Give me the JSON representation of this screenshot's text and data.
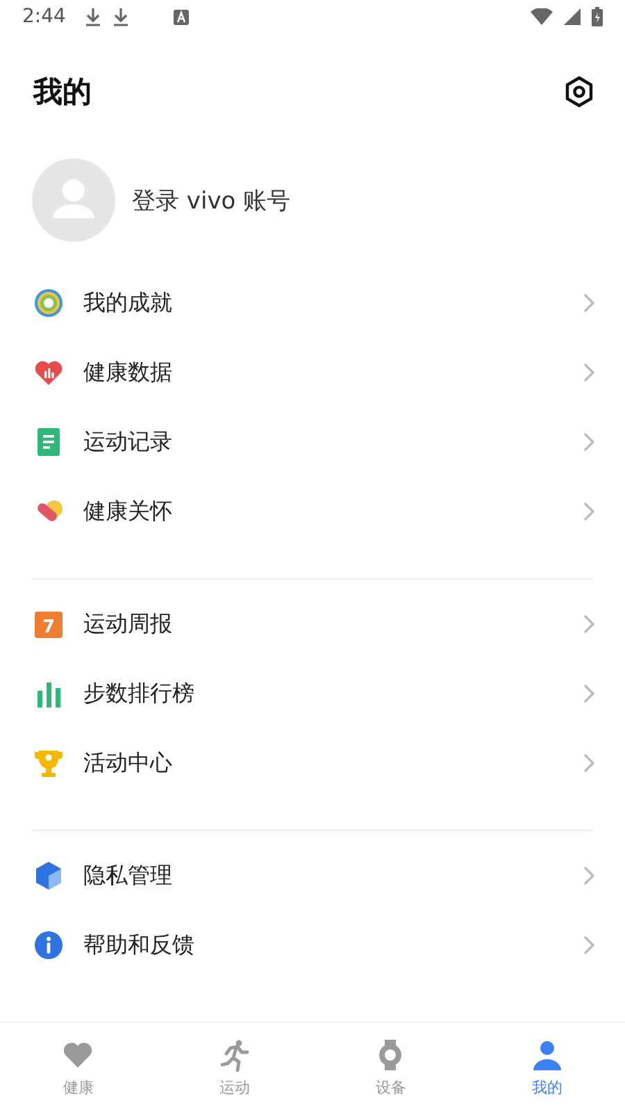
{
  "status_bar": {
    "time": "2:44"
  },
  "header": {
    "title": "我的"
  },
  "profile": {
    "login_label": "登录 vivo 账号"
  },
  "groups": [
    {
      "items": [
        {
          "label": "我的成就",
          "kind": "rings"
        },
        {
          "label": "健康数据",
          "kind": "heart"
        },
        {
          "label": "运动记录",
          "kind": "doc"
        },
        {
          "label": "健康关怀",
          "kind": "care"
        }
      ]
    },
    {
      "items": [
        {
          "label": "运动周报",
          "kind": "calendar",
          "badge": "7"
        },
        {
          "label": "步数排行榜",
          "kind": "bars"
        },
        {
          "label": "活动中心",
          "kind": "trophy"
        }
      ]
    },
    {
      "items": [
        {
          "label": "隐私管理",
          "kind": "cube"
        },
        {
          "label": "帮助和反馈",
          "kind": "info"
        }
      ]
    }
  ],
  "tabs": [
    {
      "label": "健康",
      "kind": "heart",
      "selected": false
    },
    {
      "label": "运动",
      "kind": "run",
      "selected": false
    },
    {
      "label": "设备",
      "kind": "watch",
      "selected": false
    },
    {
      "label": "我的",
      "kind": "person",
      "selected": true
    }
  ]
}
